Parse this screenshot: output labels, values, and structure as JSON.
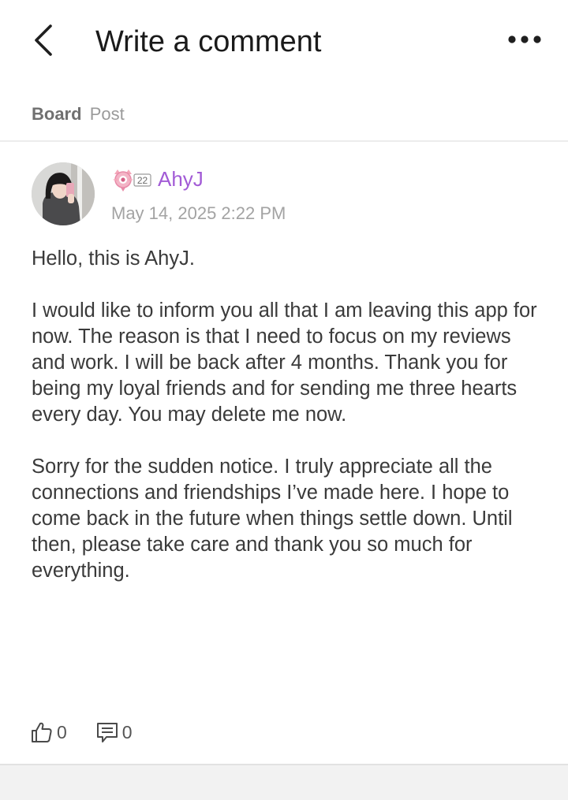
{
  "header": {
    "title": "Write a comment",
    "back_icon": "chevron-left-icon",
    "more_icon": "more-horizontal-icon"
  },
  "breadcrumb": {
    "board": "Board",
    "post": "Post"
  },
  "post": {
    "author": {
      "name": "AhyJ",
      "level": "22",
      "name_color": "#a25bd6",
      "badge_color": "#e88aa8"
    },
    "date": "May 14, 2025 2:22 PM",
    "paragraphs": [
      "Hello, this is AhyJ.",
      "I would like to inform you all that I am leaving this app for now. The reason is that I need to focus on my reviews and work. I will be back after 4 months. Thank you for being my loyal friends and for sending me three hearts every day. You may delete me now.",
      "Sorry for the sudden notice. I truly appreciate all the connections and friendships I’ve made here. I hope to come back in the future when things settle down. Until then, please take care and thank you so much for everything."
    ],
    "likes": "0",
    "comments": "0"
  }
}
